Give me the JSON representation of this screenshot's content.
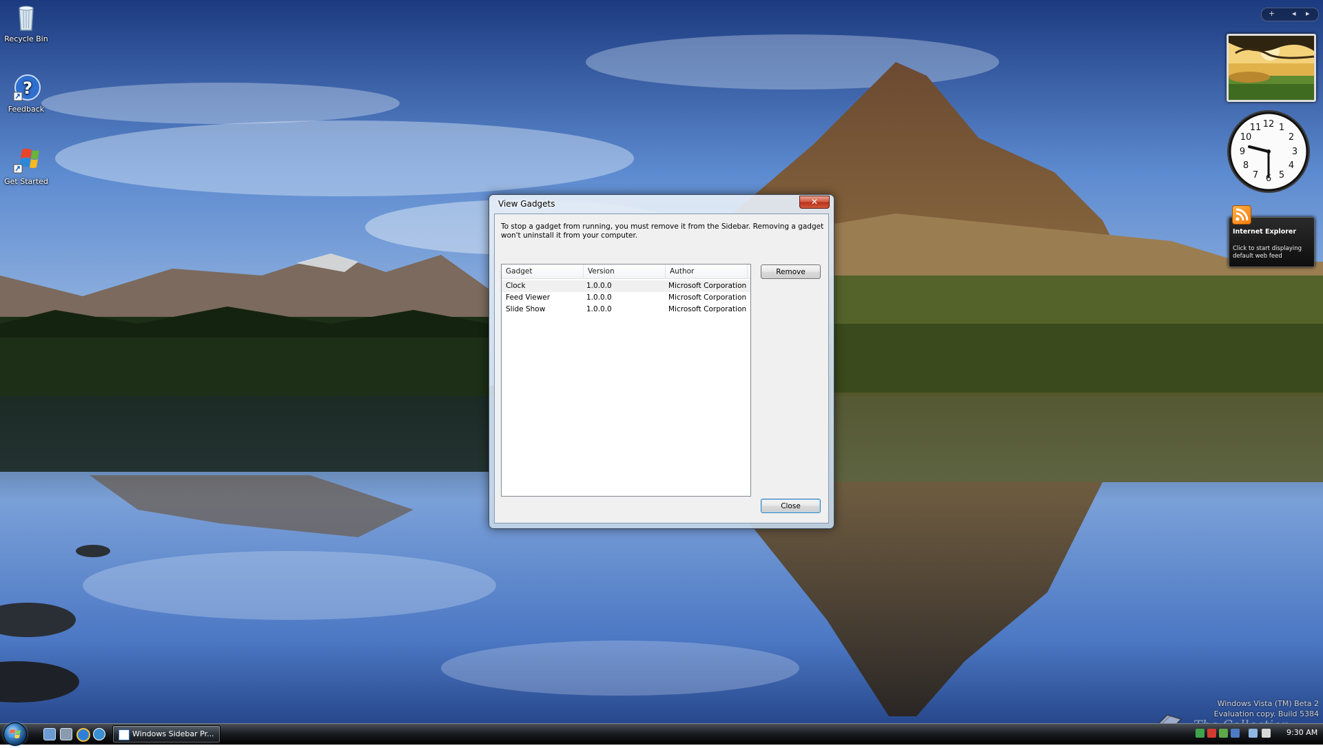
{
  "desktop": {
    "icons": [
      {
        "label": "Recycle Bin",
        "icon": "recycle-bin-icon"
      },
      {
        "label": "Feedback",
        "icon": "feedback-icon"
      },
      {
        "label": "Get Started",
        "icon": "windows-flag-icon"
      }
    ]
  },
  "dialog": {
    "title": "View Gadgets",
    "close_glyph": "✕",
    "message": "To stop a gadget from running, you must remove it from the Sidebar. Removing a gadget won't uninstall it from your computer.",
    "columns": [
      "Gadget",
      "Version",
      "Author"
    ],
    "rows": [
      {
        "gadget": "Clock",
        "version": "1.0.0.0",
        "author": "Microsoft Corporation"
      },
      {
        "gadget": "Feed Viewer",
        "version": "1.0.0.0",
        "author": "Microsoft Corporation"
      },
      {
        "gadget": "Slide Show",
        "version": "1.0.0.0",
        "author": "Microsoft Corporation"
      }
    ],
    "remove_label": "Remove",
    "close_label": "Close"
  },
  "sidebar": {
    "controls": [
      "+",
      "◂",
      "▸"
    ],
    "feed": {
      "title": "Internet Explorer",
      "text": "Click to start displaying default web feed"
    },
    "clock_numerals": [
      "12",
      "1",
      "2",
      "3",
      "4",
      "5",
      "6",
      "7",
      "8",
      "9",
      "10",
      "11"
    ]
  },
  "watermark": {
    "line1": "Windows Vista (TM) Beta 2",
    "line2": "Evaluation copy. Build 5384",
    "brand": "The Collection Book"
  },
  "taskbar": {
    "task_label": "Windows Sidebar Pr...",
    "time": "9:30 AM"
  }
}
